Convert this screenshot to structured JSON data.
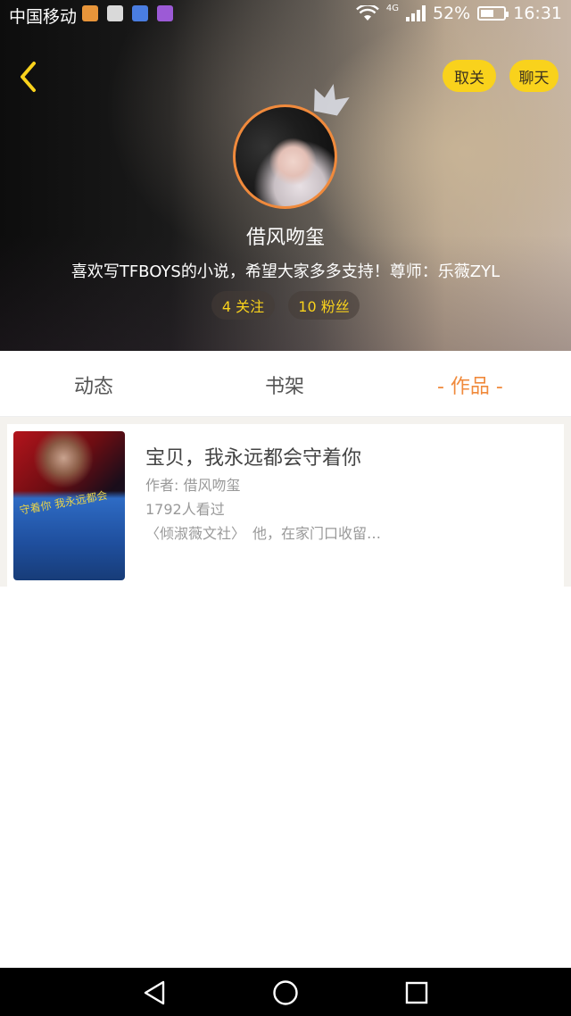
{
  "status_bar": {
    "carrier": "中国移动",
    "network": "4G",
    "battery": "52%",
    "time": "16:31"
  },
  "header": {
    "unfollow_label": "取关",
    "chat_label": "聊天"
  },
  "profile": {
    "nickname": "借风吻玺",
    "bio": "喜欢写TFBOYS的小说，希望大家多多支持！尊师：乐薇ZYL",
    "following": "4 关注",
    "fans": "10 粉丝"
  },
  "tabs": {
    "dynamic": "动态",
    "bookshelf": "书架",
    "works": "- 作品 -"
  },
  "works": [
    {
      "title": "宝贝，我永远都会守着你",
      "author": "作者: 借风吻玺",
      "views": "1792人看过",
      "desc": "〈倾淑薇文社〉　他，在家门口收留…",
      "cover_text": "守着你 我永远都会"
    }
  ],
  "colors": {
    "accent": "#f08a3c",
    "pill": "#f9d21c"
  }
}
